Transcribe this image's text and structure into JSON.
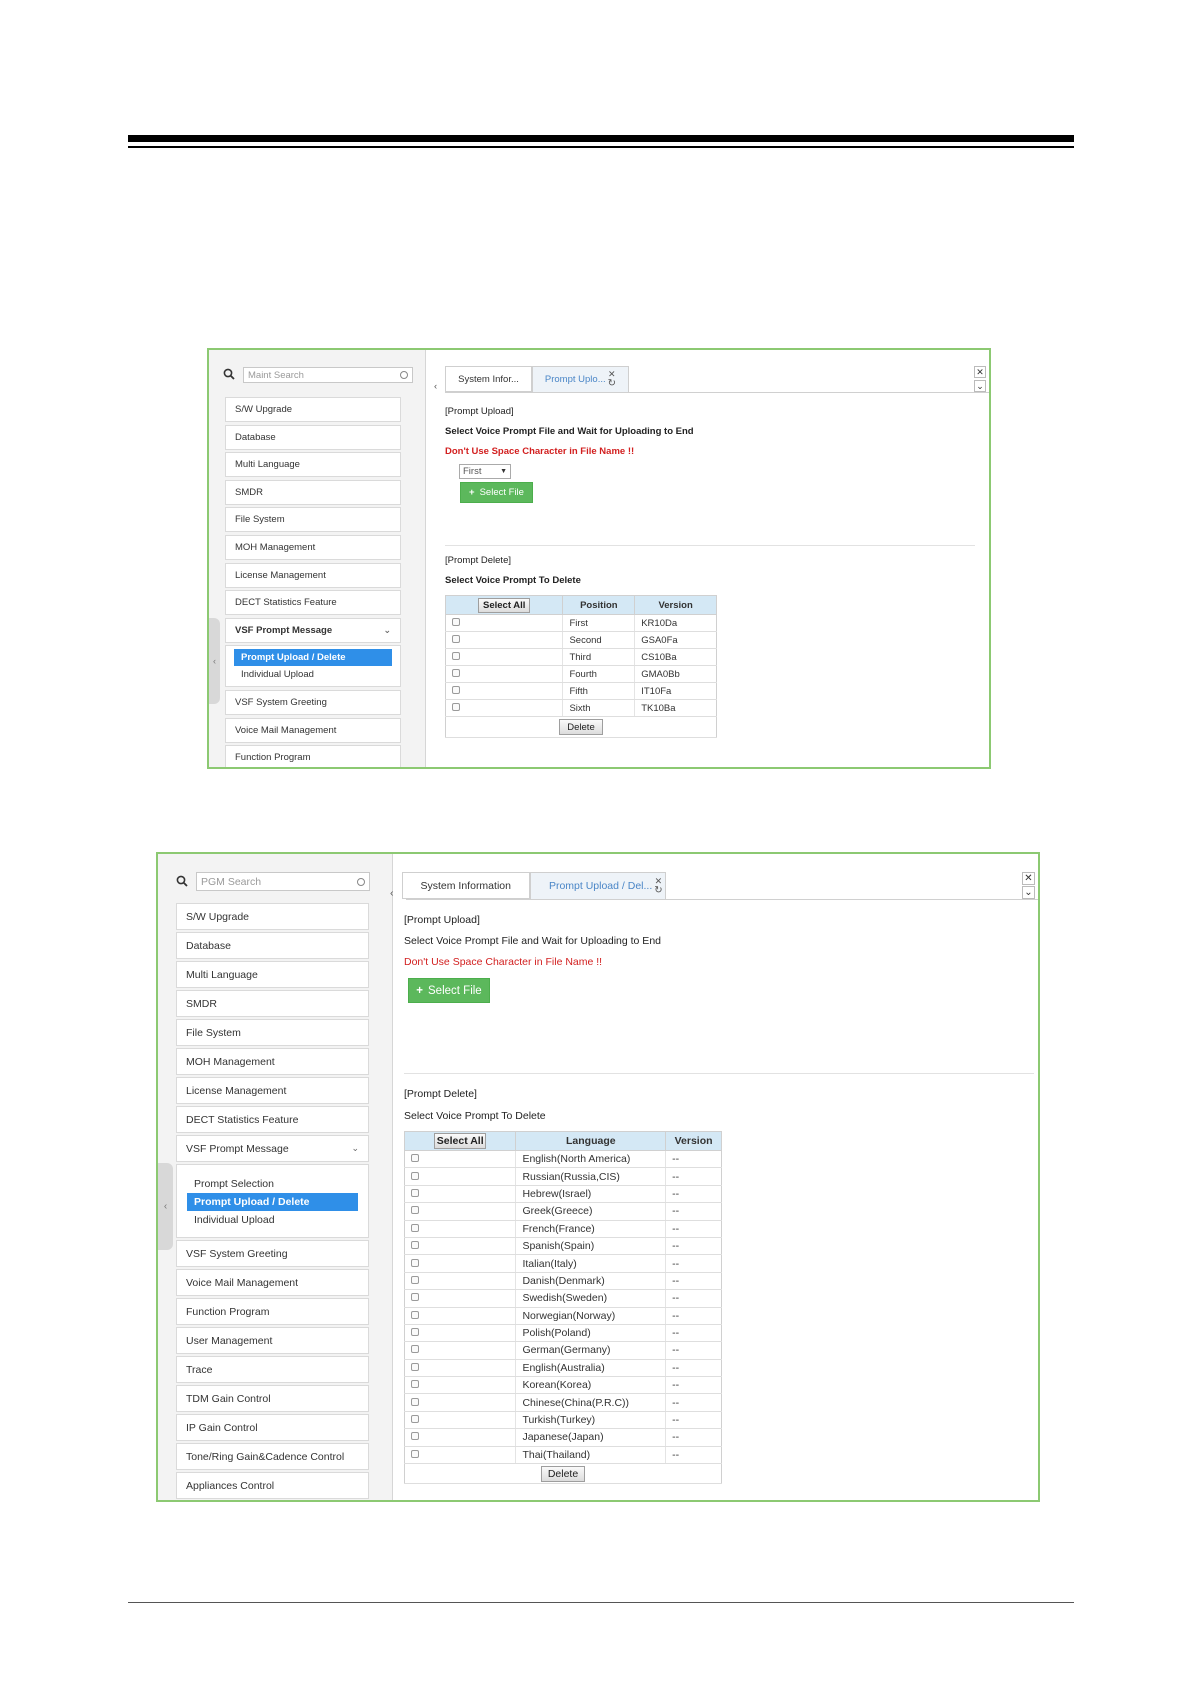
{
  "screenshot1": {
    "search_placeholder": "Maint Search",
    "menu_items": [
      "S/W Upgrade",
      "Database",
      "Multi Language",
      "SMDR",
      "File System",
      "MOH Management",
      "License Management",
      "DECT Statistics Feature"
    ],
    "expanded_item": "VSF Prompt Message",
    "sub_items": [
      "Prompt Upload / Delete",
      "Individual Upload"
    ],
    "menu_items_after": [
      "VSF System Greeting",
      "Voice Mail Management",
      "Function Program"
    ],
    "tab_prev": "‹",
    "tabs": [
      "System Infor...",
      "Prompt Uplo..."
    ],
    "upload_title": "[Prompt Upload]",
    "upload_instruction": "Select Voice Prompt File and Wait for Uploading to End",
    "warning": "Don't Use Space Character in File Name !!",
    "position_select": "First",
    "select_file": "Select File",
    "delete_title": "[Prompt Delete]",
    "delete_instruction": "Select Voice Prompt To Delete",
    "col_select_all": "Select All",
    "col_name": "Position",
    "col_version": "Version",
    "rows": [
      {
        "name": "First",
        "version": "KR10Da"
      },
      {
        "name": "Second",
        "version": "GSA0Fa"
      },
      {
        "name": "Third",
        "version": "CS10Ba"
      },
      {
        "name": "Fourth",
        "version": "GMA0Bb"
      },
      {
        "name": "Fifth",
        "version": "IT10Fa"
      },
      {
        "name": "Sixth",
        "version": "TK10Ba"
      }
    ],
    "delete_button": "Delete"
  },
  "screenshot2": {
    "search_placeholder": "PGM Search",
    "menu_items": [
      "S/W Upgrade",
      "Database",
      "Multi Language",
      "SMDR",
      "File System",
      "MOH Management",
      "License Management",
      "DECT Statistics Feature"
    ],
    "expanded_item": "VSF Prompt Message",
    "sub_items": [
      "Prompt Selection",
      "Prompt Upload / Delete",
      "Individual Upload"
    ],
    "menu_items_after": [
      "VSF System Greeting",
      "Voice Mail Management",
      "Function Program",
      "User Management",
      "Trace",
      "TDM Gain Control",
      "IP Gain Control",
      "Tone/Ring Gain&Cadence Control",
      "Appliances Control"
    ],
    "tab_prev": "‹",
    "tabs": [
      "System Information",
      "Prompt Upload / Del..."
    ],
    "upload_title": "[Prompt Upload]",
    "upload_instruction": "Select Voice Prompt File and Wait for Uploading to End",
    "warning": "Don't Use Space Character in File Name !!",
    "select_file": "Select File",
    "delete_title": "[Prompt Delete]",
    "delete_instruction": "Select Voice Prompt To Delete",
    "col_select_all": "Select All",
    "col_name": "Language",
    "col_version": "Version",
    "rows": [
      {
        "name": "English(North America)",
        "version": "--"
      },
      {
        "name": "Russian(Russia,CIS)",
        "version": "--"
      },
      {
        "name": "Hebrew(Israel)",
        "version": "--"
      },
      {
        "name": "Greek(Greece)",
        "version": "--"
      },
      {
        "name": "French(France)",
        "version": "--"
      },
      {
        "name": "Spanish(Spain)",
        "version": "--"
      },
      {
        "name": "Italian(Italy)",
        "version": "--"
      },
      {
        "name": "Danish(Denmark)",
        "version": "--"
      },
      {
        "name": "Swedish(Sweden)",
        "version": "--"
      },
      {
        "name": "Norwegian(Norway)",
        "version": "--"
      },
      {
        "name": "Polish(Poland)",
        "version": "--"
      },
      {
        "name": "German(Germany)",
        "version": "--"
      },
      {
        "name": "English(Australia)",
        "version": "--"
      },
      {
        "name": "Korean(Korea)",
        "version": "--"
      },
      {
        "name": "Chinese(China(P.R.C))",
        "version": "--"
      },
      {
        "name": "Turkish(Turkey)",
        "version": "--"
      },
      {
        "name": "Japanese(Japan)",
        "version": "--"
      },
      {
        "name": "Thai(Thailand)",
        "version": "--"
      }
    ],
    "delete_button": "Delete"
  },
  "icons": {
    "search": "search-icon",
    "clear": "clear-icon",
    "close": "close-icon",
    "refresh": "refresh-icon",
    "chevron_down": "chevron-down-icon",
    "chevron_left": "chevron-left-icon",
    "plus": "plus-icon"
  },
  "colors": {
    "frame_border": "#8cc972",
    "active_submenu": "#2f8fe8",
    "active_tab_text": "#4a86c7",
    "warning_text": "#d21f1f",
    "green_button": "#5cb85c",
    "table_header": "#d4e8f5"
  }
}
